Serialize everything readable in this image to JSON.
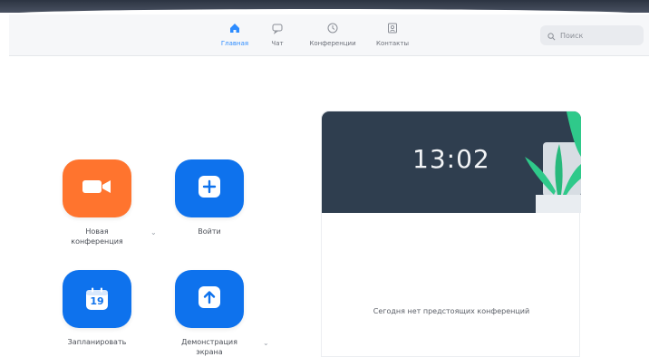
{
  "nav": {
    "tabs": [
      {
        "label": "Главная",
        "icon": "home-icon",
        "active": true
      },
      {
        "label": "Чат",
        "icon": "chat-icon",
        "active": false
      },
      {
        "label": "Конференции",
        "icon": "clock-icon",
        "active": false
      },
      {
        "label": "Контакты",
        "icon": "contacts-icon",
        "active": false
      }
    ],
    "search_placeholder": "Поиск"
  },
  "actions": {
    "new_meeting": {
      "label_line1": "Новая",
      "label_line2": "конференция",
      "icon": "video-camera-icon"
    },
    "join": {
      "label": "Войти",
      "icon": "plus-icon"
    },
    "schedule": {
      "label": "Запланировать",
      "icon": "calendar-icon",
      "calendar_day": "19"
    },
    "share": {
      "label_line1": "Демонстрация",
      "label_line2": "экрана",
      "icon": "upload-arrow-icon"
    }
  },
  "panel": {
    "clock": "13:02",
    "empty_message": "Сегодня нет предстоящих конференций"
  },
  "colors": {
    "accent": "#2d8cff",
    "orange": "#ff742e",
    "blue": "#0e72ed",
    "panel_header": "#2f3e4f",
    "plant_green": "#2fc98a"
  }
}
